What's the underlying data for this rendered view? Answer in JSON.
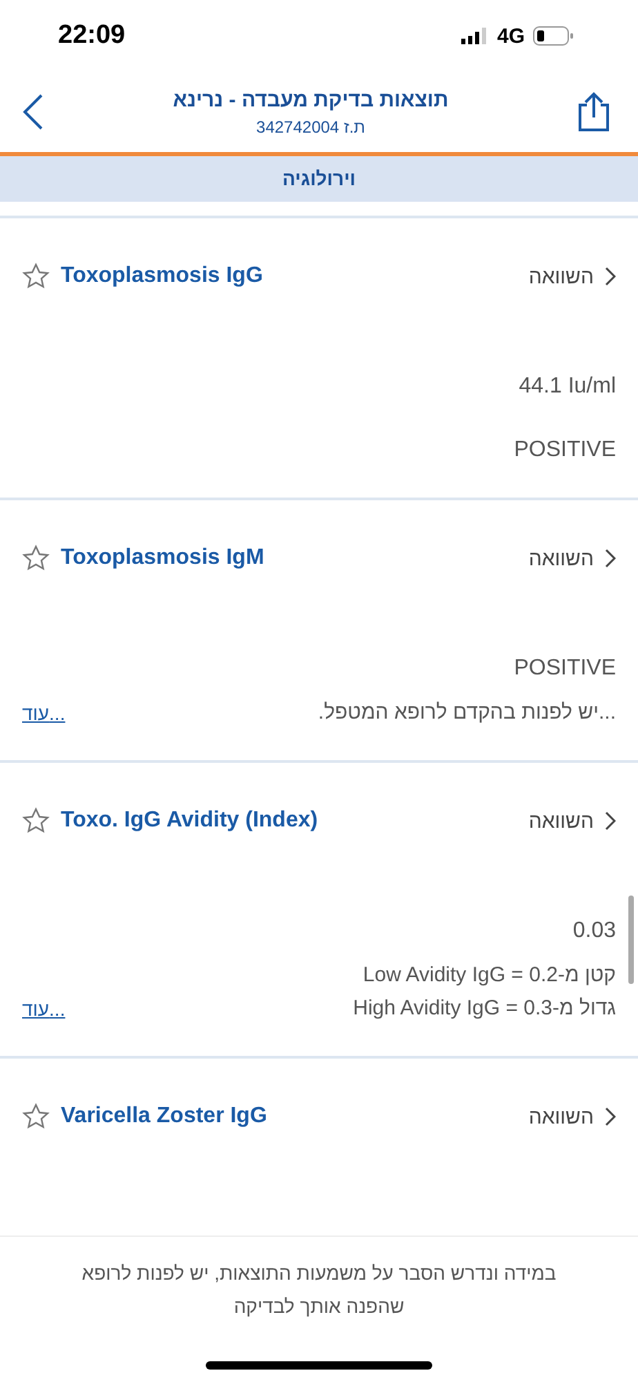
{
  "status_bar": {
    "time": "22:09",
    "network": "4G"
  },
  "header": {
    "title": "תוצאות בדיקת מעבדה - נרינא",
    "subtitle": "ת.ז 342742004"
  },
  "section": {
    "title": "וירולוגיה"
  },
  "results": [
    {
      "name": "Toxoplasmosis IgG",
      "favorite": false,
      "compare": "השוואה",
      "value": "44.1 Iu/ml",
      "result": "POSITIVE"
    },
    {
      "name": "Toxoplasmosis IgM",
      "favorite": false,
      "compare": "השוואה",
      "value": "POSITIVE",
      "notes": [
        "...יש לפנות בהקדם לרופא המטפל."
      ],
      "more": "עוד..."
    },
    {
      "name": "Toxo. IgG Avidity (Index)",
      "favorite": false,
      "compare": "השוואה",
      "value": "0.03",
      "notes": [
        "קטן מ-0.2 = Low Avidity IgG",
        "גדול מ-0.3 = High Avidity IgG"
      ],
      "more": "עוד..."
    },
    {
      "name": "Varicella Zoster IgG",
      "favorite": false,
      "compare": "השוואה"
    }
  ],
  "footer": {
    "text": "במידה ונדרש הסבר על משמעות התוצאות, יש לפנות לרופא שהפנה אותך לבדיקה"
  }
}
